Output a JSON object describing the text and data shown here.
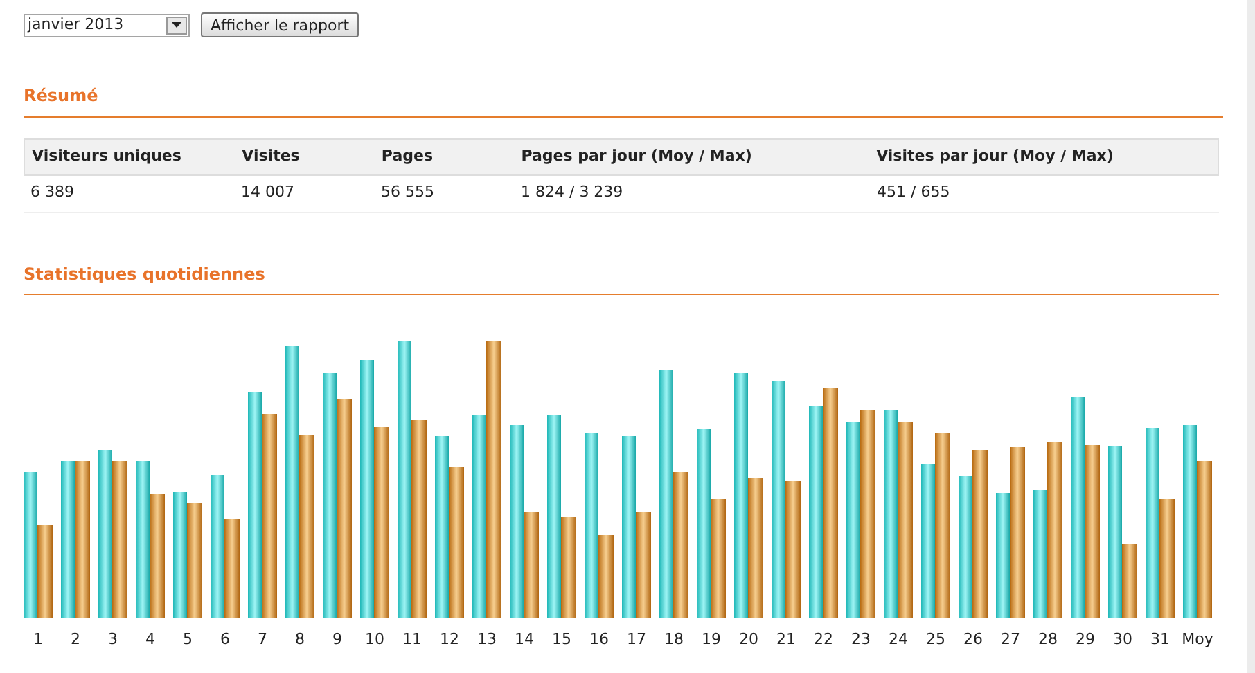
{
  "month_select": {
    "value": "janvier 2013"
  },
  "report_button": {
    "label": "Afficher le rapport"
  },
  "summary": {
    "title": "Résumé",
    "columns": [
      "Visiteurs uniques",
      "Visites",
      "Pages",
      "Pages par jour (Moy / Max)",
      "Visites par jour (Moy / Max)"
    ],
    "rows": [
      [
        "6 389",
        "14 007",
        "56 555",
        "1 824 / 3 239",
        "451 / 655"
      ]
    ]
  },
  "daily": {
    "title": "Statistiques quotidiennes",
    "day_labels": [
      "1",
      "2",
      "3",
      "4",
      "5",
      "6",
      "7",
      "8",
      "9",
      "10",
      "11",
      "12",
      "13",
      "14",
      "15",
      "16",
      "17",
      "18",
      "19",
      "20",
      "21",
      "22",
      "23",
      "24",
      "25",
      "26",
      "27",
      "28",
      "29",
      "30",
      "31",
      "Moy"
    ]
  }
}
